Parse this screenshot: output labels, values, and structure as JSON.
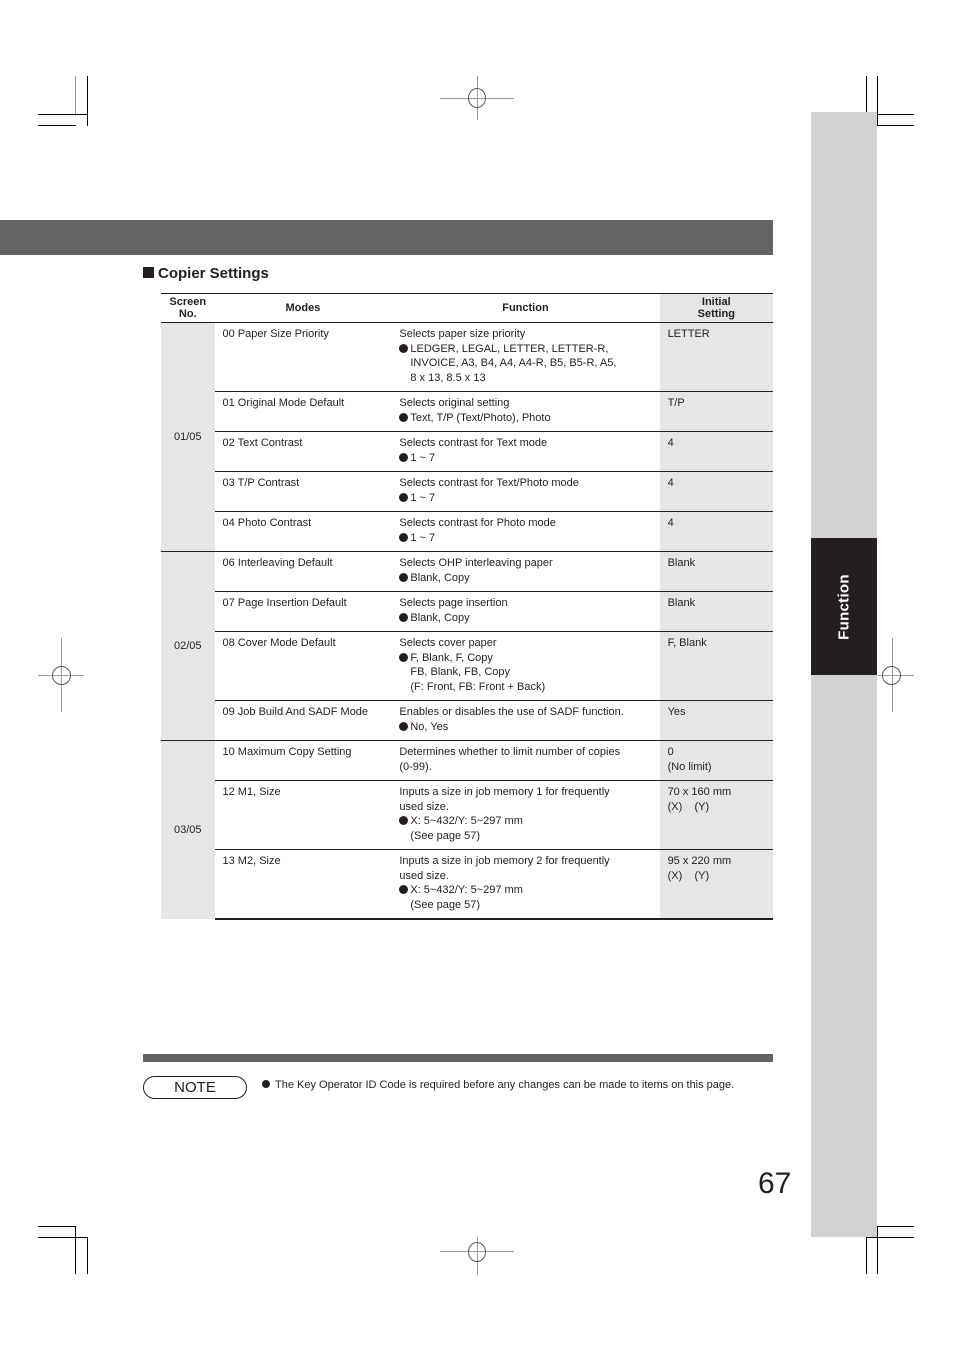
{
  "side_tab": {
    "label": "Function"
  },
  "section": {
    "title": "Copier Settings",
    "title_icon": "black-square-icon"
  },
  "table": {
    "headers": {
      "screen_no": "Screen\nNo.",
      "modes": "Modes",
      "function": "Function",
      "initial_setting": "Initial\nSetting"
    },
    "groups": [
      {
        "screen": "01/05",
        "rows": [
          {
            "mode": "00 Paper Size Priority",
            "function_desc": [
              "Selects paper size priority"
            ],
            "options": [
              "LEDGER, LEGAL, LETTER, LETTER-R,",
              "INVOICE, A3, B4, A4, A4-R, B5, B5-R, A5,",
              "8 x 13, 8.5 x 13"
            ],
            "initial": [
              "LETTER"
            ]
          },
          {
            "mode": "01 Original Mode Default",
            "function_desc": [
              "Selects original setting"
            ],
            "options": [
              "Text, T/P (Text/Photo), Photo"
            ],
            "initial": [
              "T/P"
            ]
          },
          {
            "mode": "02 Text Contrast",
            "function_desc": [
              "Selects contrast for Text mode"
            ],
            "options": [
              "1 ~ 7"
            ],
            "initial": [
              "4"
            ]
          },
          {
            "mode": "03 T/P Contrast",
            "function_desc": [
              "Selects contrast for Text/Photo mode"
            ],
            "options": [
              "1 ~ 7"
            ],
            "initial": [
              "4"
            ]
          },
          {
            "mode": "04 Photo Contrast",
            "function_desc": [
              "Selects contrast for Photo mode"
            ],
            "options": [
              "1 ~ 7"
            ],
            "initial": [
              "4"
            ]
          }
        ]
      },
      {
        "screen": "02/05",
        "rows": [
          {
            "mode": "06 Interleaving Default",
            "function_desc": [
              "Selects OHP interleaving paper"
            ],
            "options": [
              "Blank, Copy"
            ],
            "initial": [
              "Blank"
            ]
          },
          {
            "mode": "07 Page Insertion Default",
            "function_desc": [
              "Selects page insertion"
            ],
            "options": [
              "Blank, Copy"
            ],
            "initial": [
              "Blank"
            ]
          },
          {
            "mode": "08 Cover Mode Default",
            "function_desc": [
              "Selects cover paper"
            ],
            "options": [
              "F, Blank, F, Copy",
              "FB, Blank, FB, Copy",
              "(F: Front, FB: Front + Back)"
            ],
            "initial": [
              "F, Blank"
            ]
          },
          {
            "mode": "09 Job Build And SADF Mode",
            "function_desc": [
              "Enables or disables the use of SADF function."
            ],
            "options": [
              "No, Yes"
            ],
            "initial": [
              "Yes"
            ]
          }
        ]
      },
      {
        "screen": "03/05",
        "rows": [
          {
            "mode": "10 Maximum Copy Setting",
            "function_desc": [
              "Determines whether to limit number of copies",
              "(0-99)."
            ],
            "options": [],
            "initial": [
              "0",
              "(No limit)"
            ]
          },
          {
            "mode": "12 M1, Size",
            "function_desc": [
              "Inputs a size in job memory 1 for frequently",
              "used size."
            ],
            "options": [
              "X: 5~432/Y: 5~297 mm",
              "(See page 57)"
            ],
            "initial": [
              "70 x 160 mm",
              "(X)    (Y)"
            ]
          },
          {
            "mode": "13 M2, Size",
            "function_desc": [
              "Inputs a size in job memory 2 for frequently",
              "used size."
            ],
            "options": [
              "X: 5~432/Y: 5~297 mm",
              "(See page 57)"
            ],
            "initial": [
              "95 x 220 mm",
              "(X)    (Y)"
            ]
          }
        ]
      }
    ]
  },
  "note": {
    "badge": "NOTE",
    "text": "The Key Operator ID Code is required before any changes can be made to items on this page."
  },
  "page_number": "67",
  "colors": {
    "band": "#656263",
    "side_bar": "#d2d2d2",
    "side_tab": "#231f20",
    "cell_shade": "#e6e6e6",
    "text": "#231f20"
  }
}
